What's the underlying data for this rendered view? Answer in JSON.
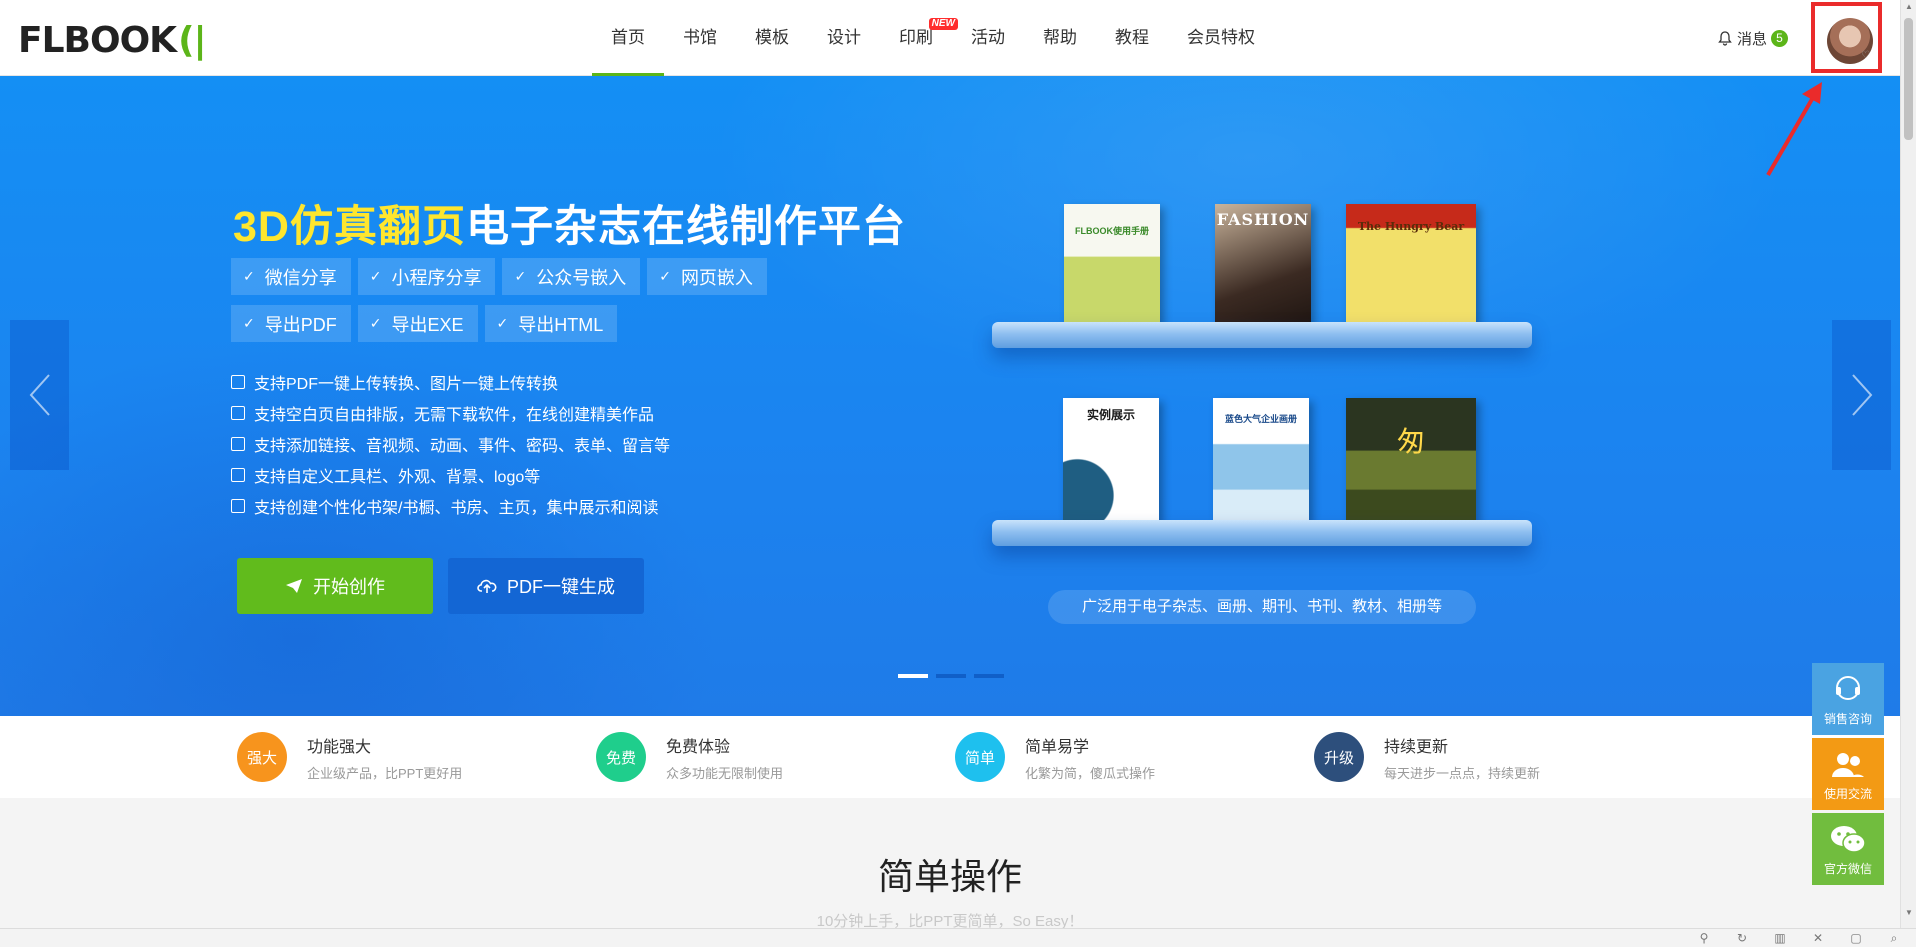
{
  "header": {
    "logo": "FLBOOK",
    "logo_bracket": "(|",
    "nav": [
      {
        "label": "首页",
        "active": true
      },
      {
        "label": "书馆"
      },
      {
        "label": "模板"
      },
      {
        "label": "设计"
      },
      {
        "label": "印刷",
        "badge": "NEW"
      },
      {
        "label": "活动"
      },
      {
        "label": "帮助"
      },
      {
        "label": "教程"
      },
      {
        "label": "会员特权"
      }
    ],
    "messages_label": "消息",
    "messages_count": "5"
  },
  "hero": {
    "title_highlight": "3D仿真翻页",
    "title_rest": "电子杂志在线制作平台",
    "tags": [
      "微信分享",
      "小程序分享",
      "公众号嵌入",
      "网页嵌入",
      "导出PDF",
      "导出EXE",
      "导出HTML"
    ],
    "features": [
      "支持PDF一键上传转换、图片一键上传转换",
      "支持空白页自由排版，无需下载软件，在线创建精美作品",
      "支持添加链接、音视频、动画、事件、密码、表单、留言等",
      "支持自定义工具栏、外观、背景、logo等",
      "支持创建个性化书架/书橱、书房、主页，集中展示和阅读"
    ],
    "start_button": "开始创作",
    "pdf_button": "PDF一键生成",
    "caption": "广泛用于电子杂志、画册、期刊、书刊、教材、相册等",
    "books": {
      "b1": "FLBOOK使用手册",
      "b2": "FASHION",
      "b3": "The Hungry Bear",
      "b4": "实例展示",
      "b5": "蓝色大气企业画册",
      "b6": "匆"
    },
    "slide_count": 3,
    "active_slide": 1
  },
  "advantages": [
    {
      "badge": "强大",
      "title": "功能强大",
      "desc": "企业级产品，比PPT更好用",
      "color": "#f7941d"
    },
    {
      "badge": "免费",
      "title": "免费体验",
      "desc": "众多功能无限制使用",
      "color": "#1fce8c"
    },
    {
      "badge": "简单",
      "title": "简单易学",
      "desc": "化繁为简，傻瓜式操作",
      "color": "#1ec0ee"
    },
    {
      "badge": "升级",
      "title": "持续更新",
      "desc": "每天进步一点点，持续更新",
      "color": "#2d4f7c"
    }
  ],
  "section": {
    "title": "简单操作",
    "subtitle": "10分钟上手，比PPT更简单，So Easy！"
  },
  "float_panel": [
    {
      "label": "销售咨询"
    },
    {
      "label": "使用交流"
    },
    {
      "label": "官方微信"
    }
  ]
}
